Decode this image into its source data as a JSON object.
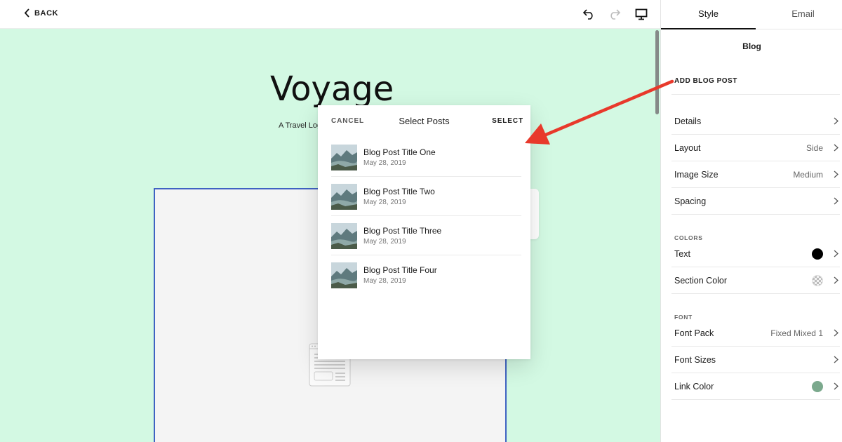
{
  "topbar": {
    "back_label": "BACK",
    "tools": [
      "undo-icon",
      "redo-icon",
      "desktop-preview-icon"
    ]
  },
  "site": {
    "title": "Voyage",
    "subtitle": "A Travel Log"
  },
  "modal": {
    "cancel_label": "CANCEL",
    "title": "Select Posts",
    "select_label": "SELECT",
    "posts": [
      {
        "title": "Blog Post Title One",
        "date": "May 28, 2019"
      },
      {
        "title": "Blog Post Title Two",
        "date": "May 28, 2019"
      },
      {
        "title": "Blog Post Title Three",
        "date": "May 28, 2019"
      },
      {
        "title": "Blog Post Title Four",
        "date": "May 28, 2019"
      }
    ]
  },
  "panel": {
    "tabs": [
      {
        "label": "Style",
        "active": true
      },
      {
        "label": "Email",
        "active": false
      }
    ],
    "title": "Blog",
    "add_post_label": "ADD BLOG POST",
    "rows": [
      {
        "label": "Details",
        "value": ""
      },
      {
        "label": "Layout",
        "value": "Side"
      },
      {
        "label": "Image Size",
        "value": "Medium"
      },
      {
        "label": "Spacing",
        "value": ""
      }
    ],
    "colors_heading": "COLORS",
    "color_rows": [
      {
        "label": "Text",
        "swatch": "#000000"
      },
      {
        "label": "Section Color",
        "swatch": "transparent-checker"
      }
    ],
    "font_heading": "FONT",
    "font_rows": [
      {
        "label": "Font Pack",
        "value": "Fixed Mixed 1"
      },
      {
        "label": "Font Sizes",
        "value": ""
      },
      {
        "label": "Link Color",
        "swatch": "#7ba98d"
      }
    ]
  },
  "colors": {
    "canvas_bg": "#d3f9e3",
    "block_border": "#3f63c2",
    "annotation_arrow": "#e8392b"
  }
}
